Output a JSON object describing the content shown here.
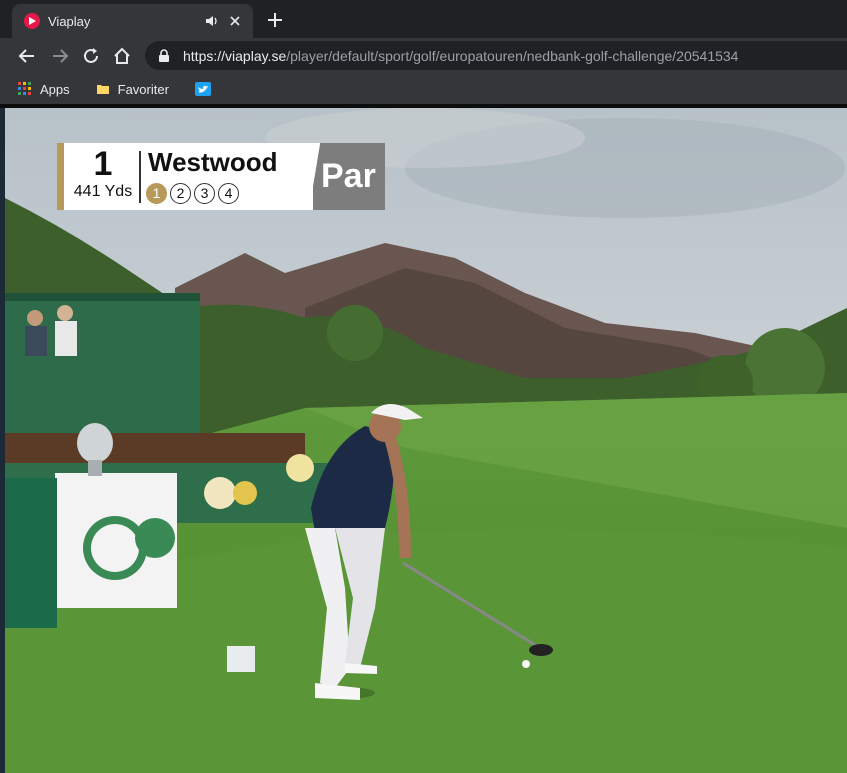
{
  "browser": {
    "tab": {
      "title": "Viaplay",
      "favicon": "viaplay-logo-icon",
      "audio": "speaker-icon"
    },
    "address": {
      "host": "https://viaplay.se",
      "path": "/player/default/sport/golf/europatouren/nedbank-golf-challenge/20541534"
    },
    "bookmarks": [
      {
        "label": "Apps",
        "icon": "apps-grid-icon"
      },
      {
        "label": "Favoriter",
        "icon": "folder-icon"
      },
      {
        "label": "",
        "icon": "twitter-icon"
      }
    ]
  },
  "scorebug": {
    "hole": "1",
    "yardage": "441 Yds",
    "player": "Westwood",
    "shots": [
      "1",
      "2",
      "3",
      "4"
    ],
    "active_shot": "1",
    "par_label": "Par"
  },
  "colors": {
    "accent_gold": "#b7995a",
    "chrome_dark": "#202124",
    "chrome": "#35363a",
    "par_grey": "#7d7d7d"
  }
}
